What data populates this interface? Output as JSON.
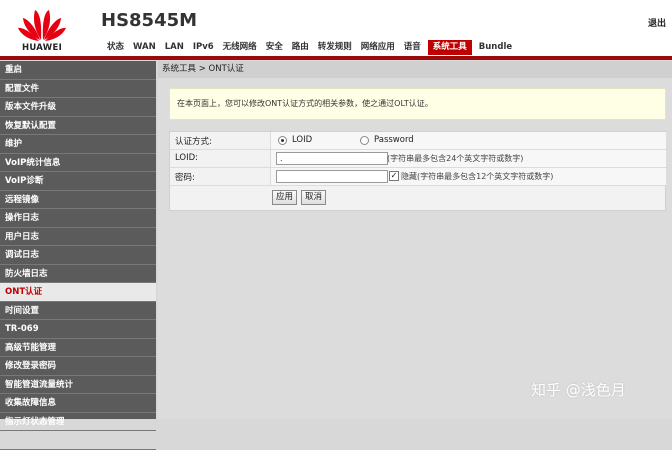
{
  "header": {
    "brand": "HUAWEI",
    "model": "HS8545M",
    "logout": "退出",
    "tabs": [
      {
        "label": "状态"
      },
      {
        "label": "WAN"
      },
      {
        "label": "LAN"
      },
      {
        "label": "IPv6"
      },
      {
        "label": "无线网络"
      },
      {
        "label": "安全"
      },
      {
        "label": "路由"
      },
      {
        "label": "转发规则"
      },
      {
        "label": "网络应用"
      },
      {
        "label": "语音"
      },
      {
        "label": "系统工具",
        "active": true
      },
      {
        "label": "Bundle"
      }
    ],
    "accent": "#c00000"
  },
  "sidebar": {
    "items": [
      {
        "label": "重启"
      },
      {
        "label": "配置文件"
      },
      {
        "label": "版本文件升级"
      },
      {
        "label": "恢复默认配置"
      },
      {
        "label": "维护"
      },
      {
        "label": "VoIP统计信息"
      },
      {
        "label": "VoIP诊断"
      },
      {
        "label": "远程镜像"
      },
      {
        "label": "操作日志"
      },
      {
        "label": "用户日志"
      },
      {
        "label": "调试日志"
      },
      {
        "label": "防火墙日志"
      },
      {
        "label": "ONT认证",
        "active": true
      },
      {
        "label": "时间设置"
      },
      {
        "label": "TR-069"
      },
      {
        "label": "高级节能管理"
      },
      {
        "label": "修改登录密码"
      },
      {
        "label": "智能管道流量统计"
      },
      {
        "label": "收集故障信息"
      },
      {
        "label": "指示灯状态管理"
      },
      {
        "label": ""
      }
    ]
  },
  "main": {
    "breadcrumb": "系统工具 > ONT认证",
    "notice": "在本页面上，您可以修改ONT认证方式的相关参数，使之通过OLT认证。",
    "form": {
      "auth_label": "认证方式:",
      "opt_loid": "LOID",
      "opt_password": "Password",
      "loid_label": "LOID:",
      "loid_value": ".",
      "loid_hint": "(字符串最多包含24个英文字符或数字)",
      "pwd_label": "密码:",
      "pwd_value": "",
      "hide_label": "隐藏(字符串最多包含12个英文字符或数字)",
      "hide_checked": true,
      "apply": "应用",
      "cancel": "取消"
    }
  },
  "watermark": "知乎 @浅色月"
}
